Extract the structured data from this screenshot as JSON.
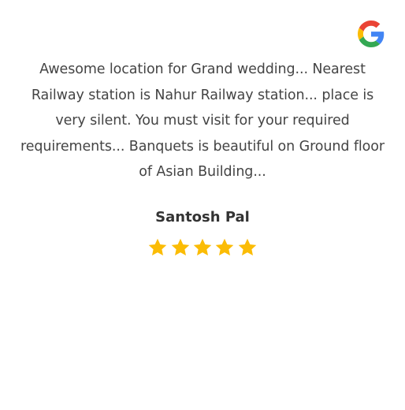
{
  "review": {
    "text": "Awesome location for Grand wedding... Nearest Railway station is Nahur Railway station... place is very silent. You must visit for your required requirements... Banquets is beautiful on Ground floor of Asian Building...",
    "reviewer_name": "Santosh Pal",
    "rating": 5,
    "rating_max": 5,
    "source_icon": "google-icon"
  },
  "colors": {
    "star": "#FBBC05",
    "text": "#444444",
    "name": "#333333",
    "google_blue": "#4285F4",
    "google_red": "#EA4335",
    "google_yellow": "#FBBC05",
    "google_green": "#34A853"
  }
}
